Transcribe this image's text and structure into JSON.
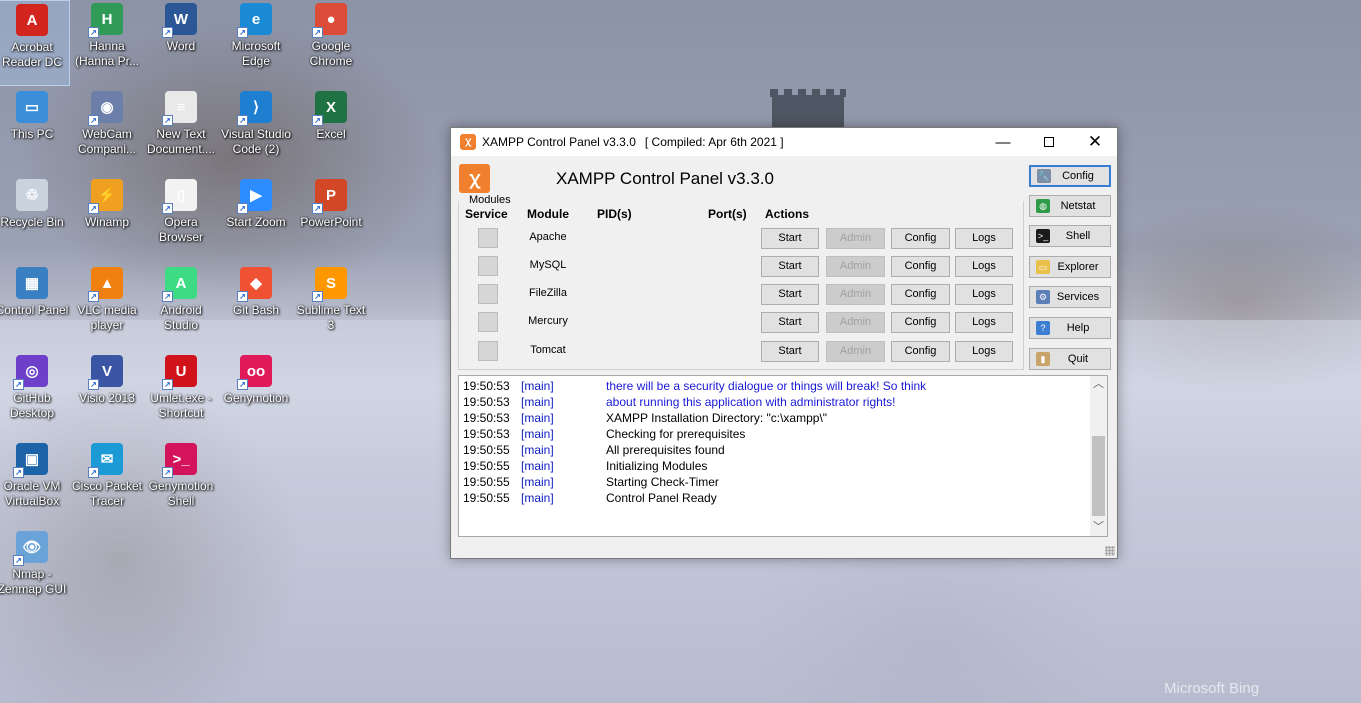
{
  "desktop": {
    "icons": [
      {
        "label": "Acrobat Reader DC",
        "icon": "acrobat-icon",
        "color": "#d1251e",
        "glyph": "A"
      },
      {
        "label": "Hanna (Hanna Pr...",
        "icon": "chrome-profile-icon",
        "color": "#2f9b57",
        "glyph": "H"
      },
      {
        "label": "Word",
        "icon": "word-icon",
        "color": "#2b5797",
        "glyph": "W"
      },
      {
        "label": "Microsoft Edge",
        "icon": "edge-icon",
        "color": "#1a8ad4",
        "glyph": "e"
      },
      {
        "label": "Google Chrome",
        "icon": "chrome-icon",
        "color": "#dd4b39",
        "glyph": "●"
      },
      {
        "label": "This PC",
        "icon": "computer-icon",
        "color": "#3b8fd9",
        "glyph": "▭"
      },
      {
        "label": "WebCam Compani...",
        "icon": "webcam-icon",
        "color": "#6b7fa8",
        "glyph": "◉"
      },
      {
        "label": "New Text Document....",
        "icon": "text-document-icon",
        "color": "#e9e9e9",
        "glyph": "≡"
      },
      {
        "label": "Visual Studio Code (2)",
        "icon": "vscode-icon",
        "color": "#1e7fd1",
        "glyph": "⟩"
      },
      {
        "label": "Excel",
        "icon": "excel-icon",
        "color": "#1f7244",
        "glyph": "X"
      },
      {
        "label": "Recycle Bin",
        "icon": "recycle-bin-icon",
        "color": "#c9d3de",
        "glyph": "♲"
      },
      {
        "label": "Winamp",
        "icon": "winamp-icon",
        "color": "#f0a020",
        "glyph": "⚡"
      },
      {
        "label": "Opera Browser",
        "icon": "opera-icon",
        "color": "#f2f2f2",
        "glyph": "▯"
      },
      {
        "label": "Start Zoom",
        "icon": "zoom-icon",
        "color": "#2d8cff",
        "glyph": "▶"
      },
      {
        "label": "PowerPoint",
        "icon": "powerpoint-icon",
        "color": "#d24726",
        "glyph": "P"
      },
      {
        "label": "Control Panel",
        "icon": "control-panel-icon",
        "color": "#3a7fc1",
        "glyph": "▦"
      },
      {
        "label": "VLC media player",
        "icon": "vlc-icon",
        "color": "#f08010",
        "glyph": "▲"
      },
      {
        "label": "Android Studio",
        "icon": "android-studio-icon",
        "color": "#3ddc84",
        "glyph": "A"
      },
      {
        "label": "Git Bash",
        "icon": "git-bash-icon",
        "color": "#f05133",
        "glyph": "◆"
      },
      {
        "label": "Sublime Text 3",
        "icon": "sublime-icon",
        "color": "#ff9800",
        "glyph": "S"
      },
      {
        "label": "GitHub Desktop",
        "icon": "github-desktop-icon",
        "color": "#6e40c9",
        "glyph": "◎"
      },
      {
        "label": "Visio 2013",
        "icon": "visio-icon",
        "color": "#3955a3",
        "glyph": "V"
      },
      {
        "label": "Umlet.exe - Shortcut",
        "icon": "umlet-icon",
        "color": "#d0121a",
        "glyph": "U"
      },
      {
        "label": "Genymotion",
        "icon": "genymotion-icon",
        "color": "#e0195a",
        "glyph": "oo"
      },
      {
        "label": "Oracle VM VirtualBox",
        "icon": "virtualbox-icon",
        "color": "#1d63a8",
        "glyph": "▣"
      },
      {
        "label": "Cisco Packet Tracer",
        "icon": "packet-tracer-icon",
        "color": "#1b9ad6",
        "glyph": "✉"
      },
      {
        "label": "Genymotion Shell",
        "icon": "genymotion-shell-icon",
        "color": "#d4145a",
        "glyph": ">_"
      },
      {
        "label": "Nmap - Zenmap GUI",
        "icon": "zenmap-icon",
        "color": "#6aa3d8",
        "glyph": "👁"
      }
    ],
    "watermark": "Microsoft Bing"
  },
  "xampp": {
    "window_title": "XAMPP Control Panel v3.3.0",
    "compiled": "[ Compiled: Apr 6th 2021 ]",
    "heading": "XAMPP Control Panel v3.3.0",
    "modules_legend": "Modules",
    "headers": {
      "service": "Service",
      "module": "Module",
      "pids": "PID(s)",
      "ports": "Port(s)",
      "actions": "Actions"
    },
    "modules": [
      {
        "name": "Apache",
        "start": "Start",
        "admin": "Admin",
        "config": "Config",
        "logs": "Logs"
      },
      {
        "name": "MySQL",
        "start": "Start",
        "admin": "Admin",
        "config": "Config",
        "logs": "Logs"
      },
      {
        "name": "FileZilla",
        "start": "Start",
        "admin": "Admin",
        "config": "Config",
        "logs": "Logs"
      },
      {
        "name": "Mercury",
        "start": "Start",
        "admin": "Admin",
        "config": "Config",
        "logs": "Logs"
      },
      {
        "name": "Tomcat",
        "start": "Start",
        "admin": "Admin",
        "config": "Config",
        "logs": "Logs"
      }
    ],
    "side_buttons": [
      {
        "label": "Config",
        "icon": "wrench-icon",
        "color": "#7b8fa8",
        "glyph": "🔧"
      },
      {
        "label": "Netstat",
        "icon": "globe-icon",
        "color": "#2e9b48",
        "glyph": "◍"
      },
      {
        "label": "Shell",
        "icon": "terminal-icon",
        "color": "#1b1b1b",
        "glyph": ">_"
      },
      {
        "label": "Explorer",
        "icon": "folder-icon",
        "color": "#e8c04a",
        "glyph": "▭"
      },
      {
        "label": "Services",
        "icon": "services-icon",
        "color": "#5c7fb8",
        "glyph": "⚙"
      },
      {
        "label": "Help",
        "icon": "help-icon",
        "color": "#3d7fd4",
        "glyph": "?"
      },
      {
        "label": "Quit",
        "icon": "quit-icon",
        "color": "#c9a46a",
        "glyph": "▮"
      }
    ],
    "log": [
      {
        "time": "19:50:53",
        "src": "[main]",
        "msg": "there will be a security dialogue or things will break! So think",
        "color": "blue"
      },
      {
        "time": "19:50:53",
        "src": "[main]",
        "msg": "about running this application with administrator rights!",
        "color": "blue"
      },
      {
        "time": "19:50:53",
        "src": "[main]",
        "msg": "XAMPP Installation Directory: \"c:\\xampp\\\"",
        "color": "black"
      },
      {
        "time": "19:50:53",
        "src": "[main]",
        "msg": "Checking for prerequisites",
        "color": "black"
      },
      {
        "time": "19:50:55",
        "src": "[main]",
        "msg": "All prerequisites found",
        "color": "black"
      },
      {
        "time": "19:50:55",
        "src": "[main]",
        "msg": "Initializing Modules",
        "color": "black"
      },
      {
        "time": "19:50:55",
        "src": "[main]",
        "msg": "Starting Check-Timer",
        "color": "black"
      },
      {
        "time": "19:50:55",
        "src": "[main]",
        "msg": "Control Panel Ready",
        "color": "black"
      }
    ],
    "accent_color": "#f07f2e"
  }
}
